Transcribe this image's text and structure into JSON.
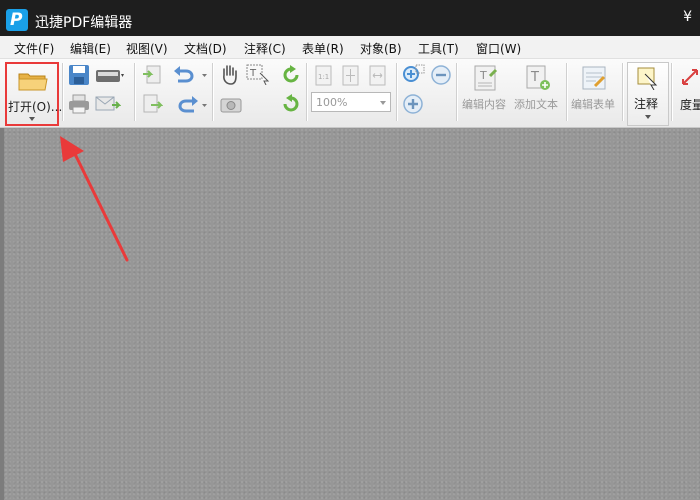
{
  "app": {
    "title": "迅捷PDF编辑器",
    "corner_symbol": "¥"
  },
  "menu": [
    {
      "label": "文件(F)"
    },
    {
      "label": "编辑(E)"
    },
    {
      "label": "视图(V)"
    },
    {
      "label": "文档(D)"
    },
    {
      "label": "注释(C)"
    },
    {
      "label": "表单(R)"
    },
    {
      "label": "对象(B)"
    },
    {
      "label": "工具(T)"
    },
    {
      "label": "窗口(W)"
    }
  ],
  "toolbar": {
    "open_label": "打开(O)...",
    "zoom_value": "100%",
    "edit_content_label": "编辑内容",
    "add_text_label": "添加文本",
    "edit_form_label": "编辑表单",
    "annotation_label": "注释",
    "measure_label": "度量"
  },
  "colors": {
    "highlight": "#e93a3a",
    "titlebar": "#1e1e1e",
    "content_bg": "#979797"
  }
}
